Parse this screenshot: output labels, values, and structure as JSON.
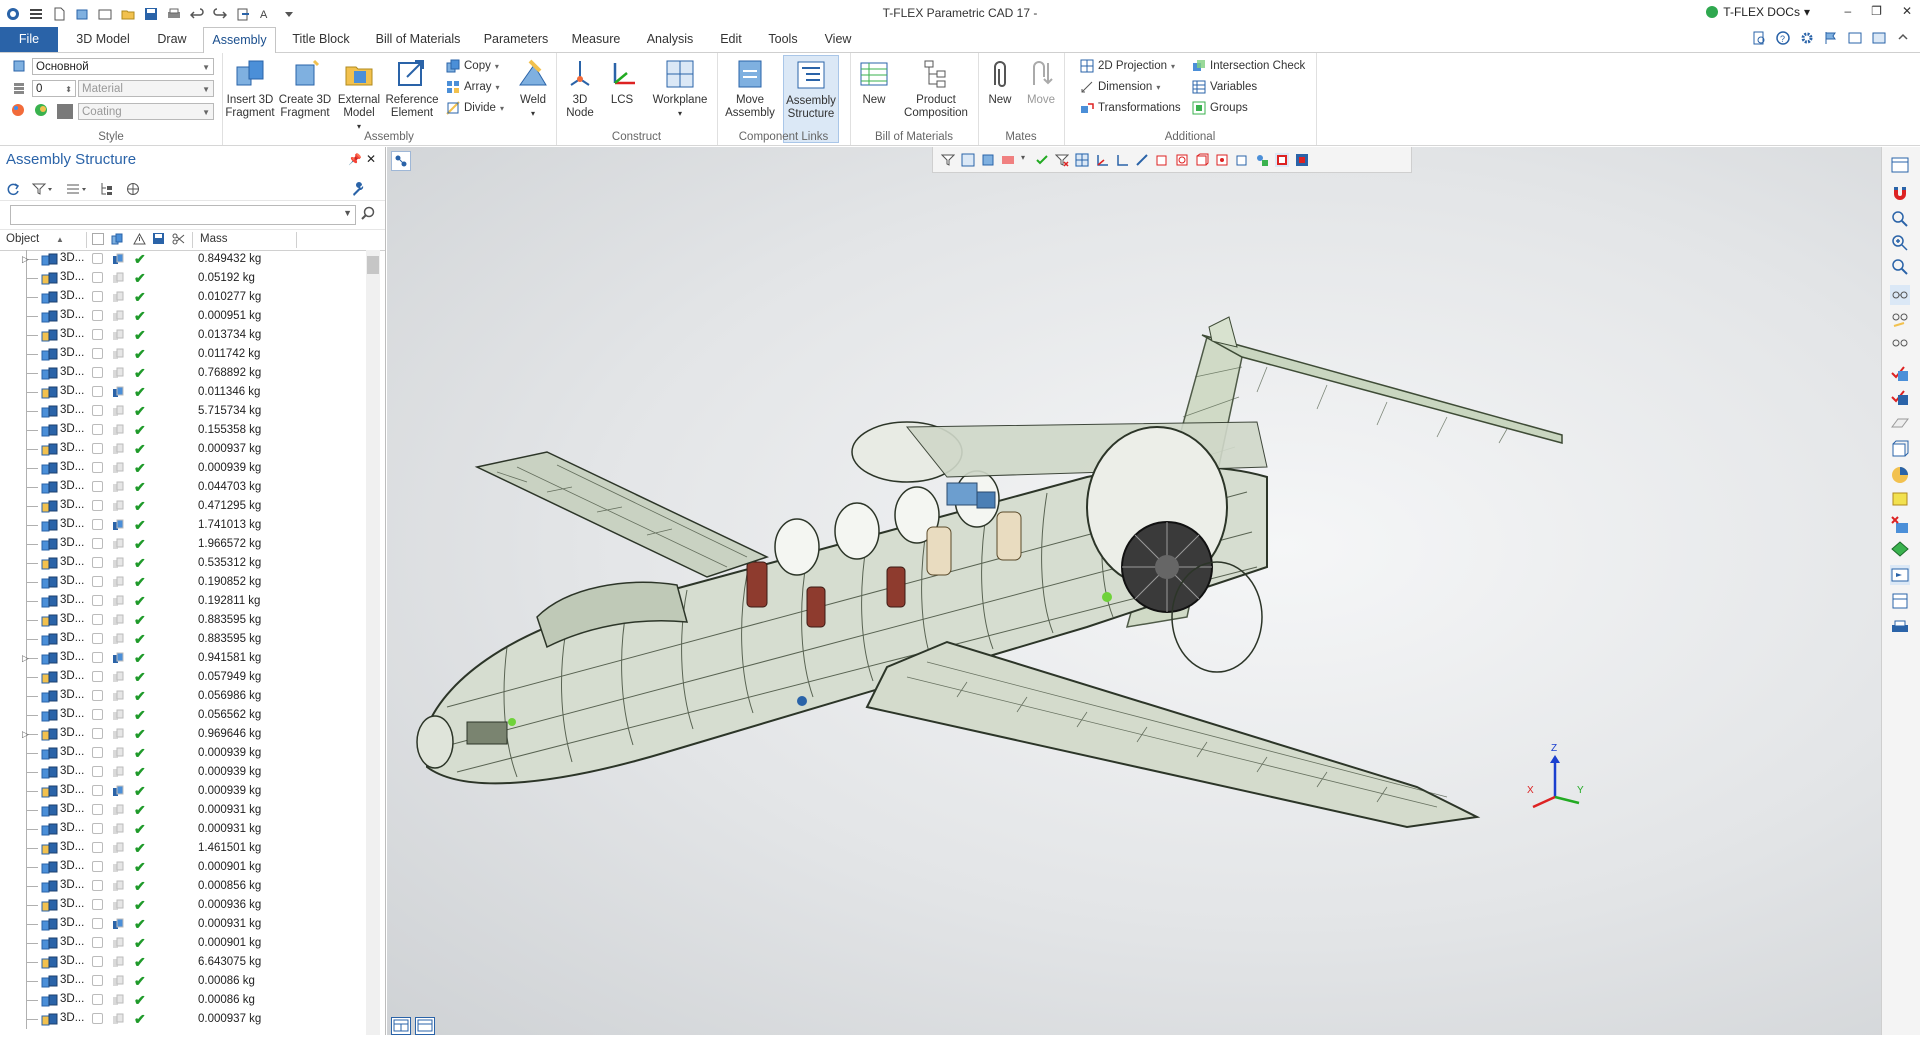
{
  "window": {
    "title": "T-FLEX Parametric CAD 17 -",
    "docs_label": "T-FLEX DOCs",
    "minimize": "–",
    "restore": "❐",
    "close": "✕"
  },
  "tabs": [
    {
      "label": "File"
    },
    {
      "label": "3D Model"
    },
    {
      "label": "Draw"
    },
    {
      "label": "Assembly"
    },
    {
      "label": "Title Block"
    },
    {
      "label": "Bill of Materials"
    },
    {
      "label": "Parameters"
    },
    {
      "label": "Measure"
    },
    {
      "label": "Analysis"
    },
    {
      "label": "Edit"
    },
    {
      "label": "Tools"
    },
    {
      "label": "View"
    }
  ],
  "ribbon": {
    "style": {
      "layer": "Основной",
      "priority": "0",
      "material_placeholder": "Material",
      "coating_placeholder": "Coating",
      "group_label": "Style"
    },
    "assembly": {
      "insert_3d_fragment": "Insert 3D\nFragment",
      "create_3d_fragment": "Create 3D\nFragment",
      "external_model": "External\nModel",
      "reference_element": "Reference\nElement",
      "copy": "Copy",
      "array": "Array",
      "divide": "Divide",
      "weld": "Weld",
      "group_label": "Assembly"
    },
    "construct": {
      "node_3d": "3D\nNode",
      "lcs": "LCS",
      "workplane": "Workplane",
      "group_label": "Construct"
    },
    "component_links": {
      "move_assembly": "Move\nAssembly",
      "assembly_structure": "Assembly\nStructure",
      "group_label": "Component Links"
    },
    "bom": {
      "new": "New",
      "product_composition": "Product\nComposition",
      "group_label": "Bill of Materials"
    },
    "mates": {
      "new": "New",
      "move": "Move",
      "group_label": "Mates"
    },
    "additional": {
      "projection_2d": "2D Projection",
      "dimension": "Dimension",
      "transformations": "Transformations",
      "intersection_check": "Intersection Check",
      "variables": "Variables",
      "groups": "Groups",
      "group_label": "Additional"
    }
  },
  "panel": {
    "title": "Assembly Structure",
    "columns": {
      "object": "Object",
      "mass": "Mass"
    },
    "rows": [
      {
        "name": "3D...",
        "mass": "0.849432 kg",
        "expand": true
      },
      {
        "name": "3D...",
        "mass": "0.05192 kg"
      },
      {
        "name": "3D...",
        "mass": "0.010277 kg"
      },
      {
        "name": "3D...",
        "mass": "0.000951 kg"
      },
      {
        "name": "3D...",
        "mass": "0.013734 kg"
      },
      {
        "name": "3D...",
        "mass": "0.011742 kg"
      },
      {
        "name": "3D...",
        "mass": "0.768892 kg"
      },
      {
        "name": "3D...",
        "mass": "0.011346 kg"
      },
      {
        "name": "3D...",
        "mass": "5.715734 kg"
      },
      {
        "name": "3D...",
        "mass": "0.155358 kg"
      },
      {
        "name": "3D...",
        "mass": "0.000937 kg"
      },
      {
        "name": "3D...",
        "mass": "0.000939 kg"
      },
      {
        "name": "3D...",
        "mass": "0.044703 kg"
      },
      {
        "name": "3D...",
        "mass": "0.471295 kg"
      },
      {
        "name": "3D...",
        "mass": "1.741013 kg"
      },
      {
        "name": "3D...",
        "mass": "1.966572 kg"
      },
      {
        "name": "3D...",
        "mass": "0.535312 kg"
      },
      {
        "name": "3D...",
        "mass": "0.190852 kg"
      },
      {
        "name": "3D...",
        "mass": "0.192811 kg"
      },
      {
        "name": "3D...",
        "mass": "0.883595 kg"
      },
      {
        "name": "3D...",
        "mass": "0.883595 kg"
      },
      {
        "name": "3D...",
        "mass": "0.941581 kg",
        "expand": true
      },
      {
        "name": "3D...",
        "mass": "0.057949 kg"
      },
      {
        "name": "3D...",
        "mass": "0.056986 kg"
      },
      {
        "name": "3D...",
        "mass": "0.056562 kg"
      },
      {
        "name": "3D...",
        "mass": "0.969646 kg",
        "expand": true
      },
      {
        "name": "3D...",
        "mass": "0.000939 kg"
      },
      {
        "name": "3D...",
        "mass": "0.000939 kg"
      },
      {
        "name": "3D...",
        "mass": "0.000939 kg"
      },
      {
        "name": "3D...",
        "mass": "0.000931 kg"
      },
      {
        "name": "3D...",
        "mass": "0.000931 kg"
      },
      {
        "name": "3D...",
        "mass": "1.461501 kg"
      },
      {
        "name": "3D...",
        "mass": "0.000901 kg"
      },
      {
        "name": "3D...",
        "mass": "0.000856 kg"
      },
      {
        "name": "3D...",
        "mass": "0.000936 kg"
      },
      {
        "name": "3D...",
        "mass": "0.000931 kg"
      },
      {
        "name": "3D...",
        "mass": "0.000901 kg"
      },
      {
        "name": "3D...",
        "mass": "6.643075 kg"
      },
      {
        "name": "3D...",
        "mass": "0.00086 kg"
      },
      {
        "name": "3D...",
        "mass": "0.00086 kg"
      },
      {
        "name": "3D...",
        "mass": "0.000937 kg"
      }
    ]
  },
  "viewport": {
    "triad": {
      "x": "X",
      "y": "Y",
      "z": "Z"
    }
  }
}
